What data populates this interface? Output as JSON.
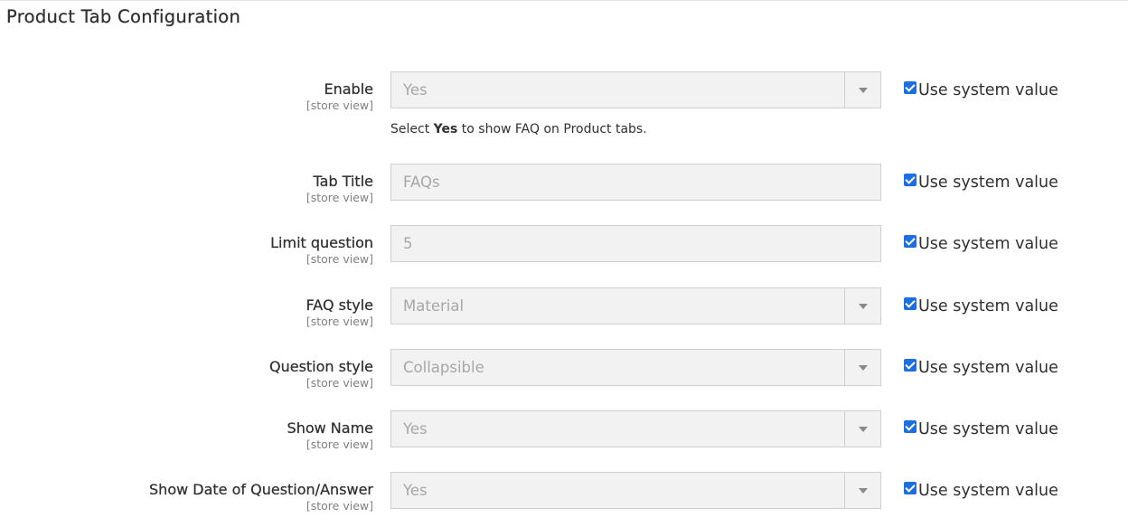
{
  "section": {
    "title": "Product Tab Configuration"
  },
  "rows": [
    {
      "label": "Enable",
      "scope": "[store view]",
      "value": "Yes",
      "type": "select",
      "system": "Use system value"
    },
    {
      "label": "Tab Title",
      "scope": "[store view]",
      "value": "FAQs",
      "type": "input",
      "system": "Use system value"
    },
    {
      "label": "Limit question",
      "scope": "[store view]",
      "value": "5",
      "type": "input",
      "system": "Use system value"
    },
    {
      "label": "FAQ style",
      "scope": "[store view]",
      "value": "Material",
      "type": "select",
      "system": "Use system value"
    },
    {
      "label": "Question style",
      "scope": "[store view]",
      "value": "Collapsible",
      "type": "select",
      "system": "Use system value"
    },
    {
      "label": "Show Name",
      "scope": "[store view]",
      "value": "Yes",
      "type": "select",
      "system": "Use system value"
    },
    {
      "label": "Show Date of Question/Answer",
      "scope": "[store view]",
      "value": "Yes",
      "type": "select",
      "system": "Use system value"
    }
  ],
  "enable_note": {
    "prefix": "Select ",
    "bold": "Yes",
    "suffix": " to show FAQ on Product tabs."
  },
  "colors": {
    "checkbox": "#1c6fe0",
    "field_bg": "#f2f2f2",
    "field_border": "#cfcfcf"
  }
}
